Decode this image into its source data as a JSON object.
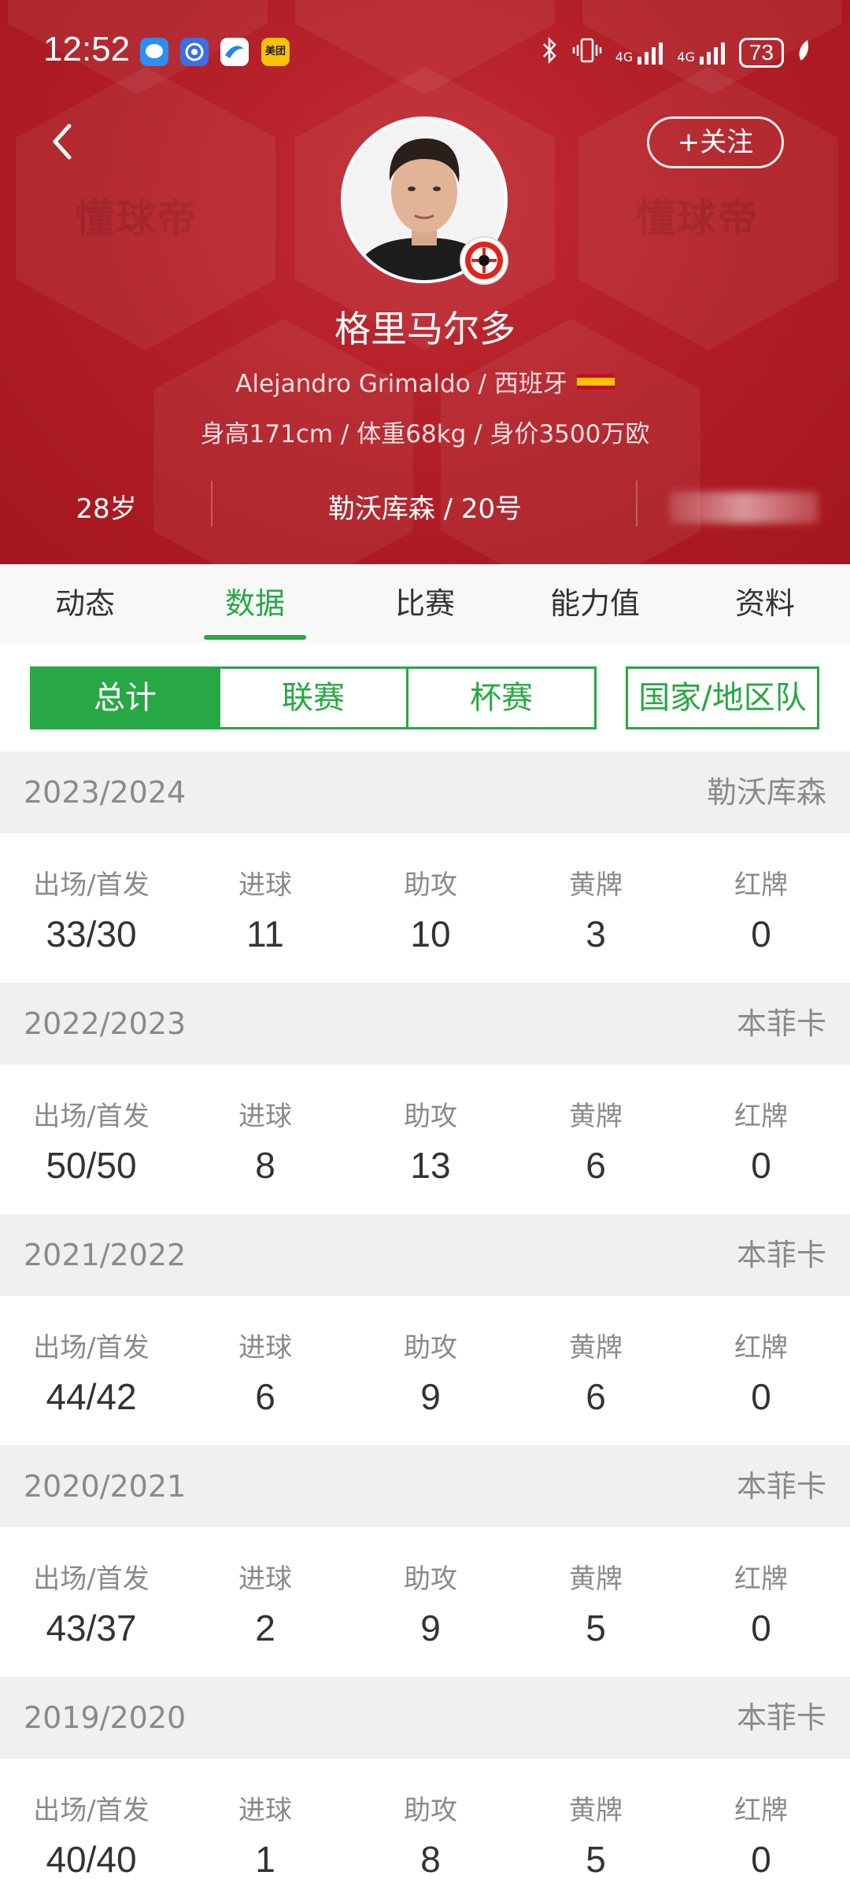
{
  "status_bar": {
    "time": "12:52",
    "battery": "73",
    "network_1": "4G",
    "network_2": "4G",
    "app_icon_meituan": "美团"
  },
  "header": {
    "follow_label": "+关注",
    "watermark": "懂球帝",
    "player_name": "格里马尔多",
    "player_latin": "Alejandro Grimaldo / 西班牙",
    "player_stats": "身高171cm / 体重68kg / 身价3500万欧",
    "age": "28岁",
    "club_number": "勒沃库森 / 20号",
    "accent_color": "#b01d25"
  },
  "tabs": [
    {
      "label": "动态"
    },
    {
      "label": "数据"
    },
    {
      "label": "比赛"
    },
    {
      "label": "能力值"
    },
    {
      "label": "资料"
    }
  ],
  "segments": {
    "total": "总计",
    "league": "联赛",
    "cup": "杯赛",
    "national": "国家/地区队",
    "active_color": "#27a844"
  },
  "stat_labels": {
    "apps": "出场/首发",
    "goals": "进球",
    "assists": "助攻",
    "yellow": "黄牌",
    "red": "红牌"
  },
  "seasons": [
    {
      "year": "2023/2024",
      "club": "勒沃库森",
      "apps": "33/30",
      "goals": "11",
      "assists": "10",
      "yellow": "3",
      "red": "0"
    },
    {
      "year": "2022/2023",
      "club": "本菲卡",
      "apps": "50/50",
      "goals": "8",
      "assists": "13",
      "yellow": "6",
      "red": "0"
    },
    {
      "year": "2021/2022",
      "club": "本菲卡",
      "apps": "44/42",
      "goals": "6",
      "assists": "9",
      "yellow": "6",
      "red": "0"
    },
    {
      "year": "2020/2021",
      "club": "本菲卡",
      "apps": "43/37",
      "goals": "2",
      "assists": "9",
      "yellow": "5",
      "red": "0"
    },
    {
      "year": "2019/2020",
      "club": "本菲卡",
      "apps": "40/40",
      "goals": "1",
      "assists": "8",
      "yellow": "5",
      "red": "0"
    }
  ]
}
